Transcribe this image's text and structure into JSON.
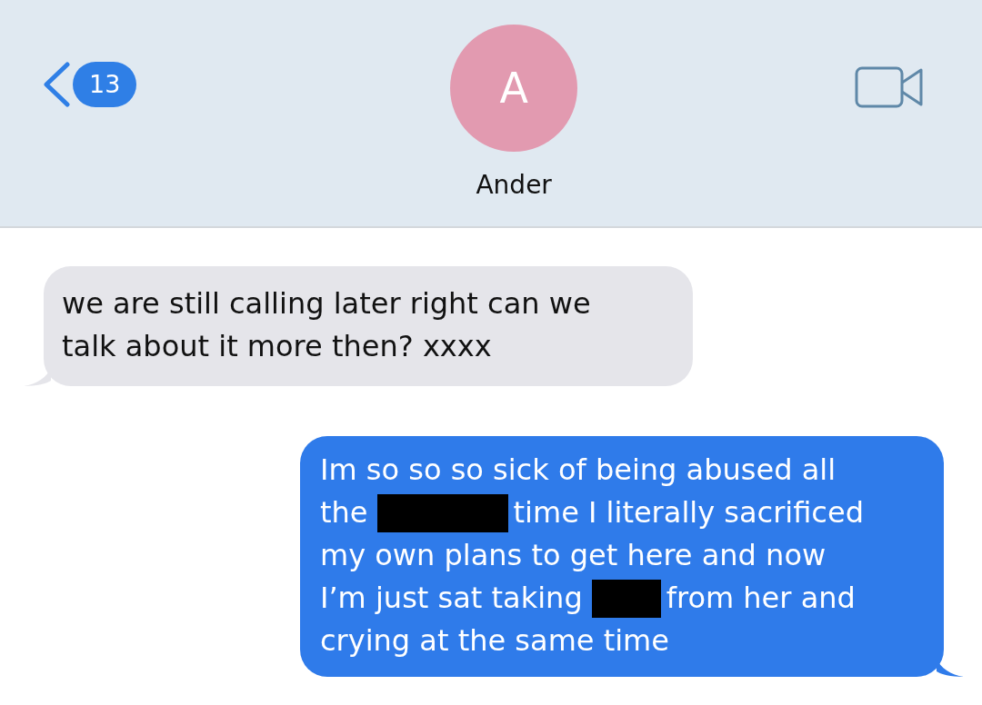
{
  "header": {
    "back_count": "13",
    "avatar_initial": "A",
    "contact_name": "Ander"
  },
  "messages": [
    {
      "kind": "incoming",
      "lines": [
        [
          {
            "kind": "text",
            "text": "we are still calling later right can we"
          }
        ],
        [
          {
            "kind": "text",
            "text": "talk about it more then? xxxx"
          }
        ]
      ]
    },
    {
      "kind": "outgoing",
      "lines": [
        [
          {
            "kind": "text",
            "text": "Im so so so sick of being abused all"
          }
        ],
        [
          {
            "kind": "text",
            "text": "the"
          },
          {
            "kind": "redacted"
          },
          {
            "kind": "text",
            "text": "time I literally sacrificed"
          }
        ],
        [
          {
            "kind": "text",
            "text": "my own plans to get here and now"
          }
        ],
        [
          {
            "kind": "text",
            "text": "I’m just sat taking"
          },
          {
            "kind": "redacted"
          },
          {
            "kind": "text",
            "text": "from her and"
          }
        ],
        [
          {
            "kind": "text",
            "text": "crying at the same time"
          }
        ]
      ]
    }
  ]
}
